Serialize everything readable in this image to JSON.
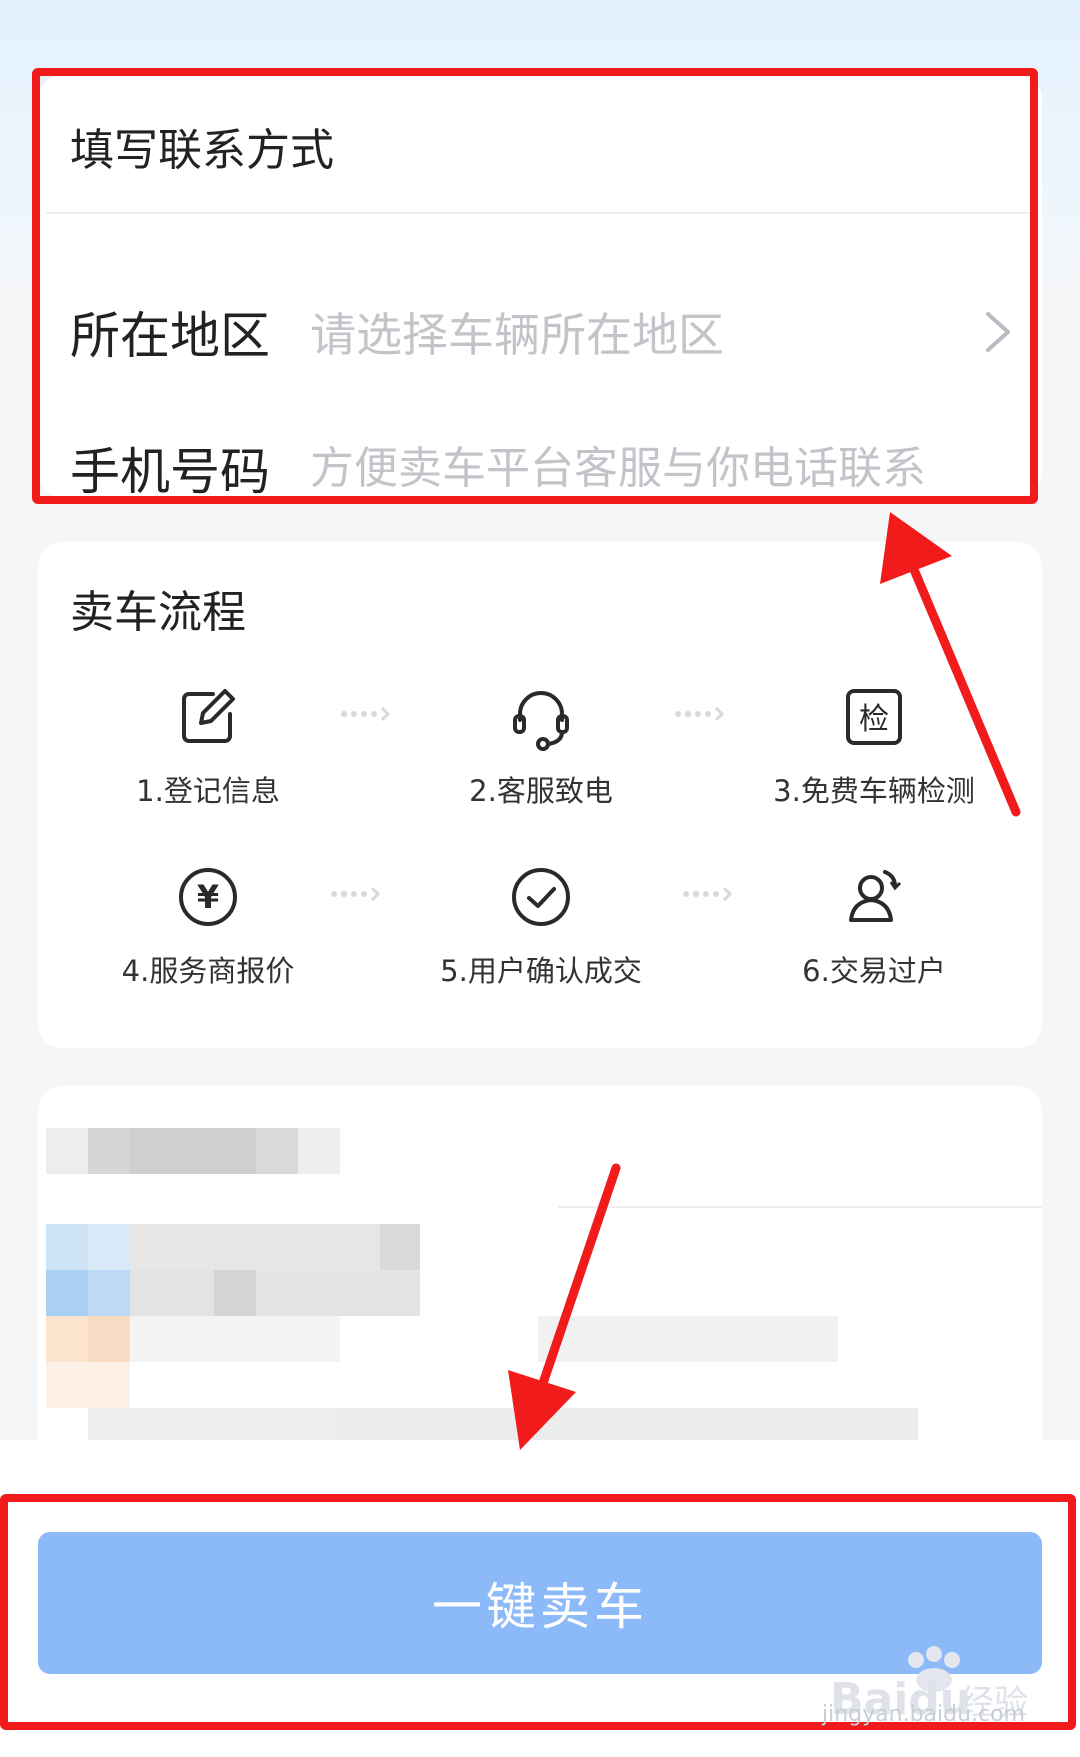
{
  "contact": {
    "title": "填写联系方式",
    "region_label": "所在地区",
    "region_placeholder": "请选择车辆所在地区",
    "phone_label": "手机号码",
    "phone_placeholder": "方便卖车平台客服与你电话联系"
  },
  "process": {
    "title": "卖车流程",
    "steps": [
      {
        "label": "1.登记信息",
        "icon": "edit-icon"
      },
      {
        "label": "2.客服致电",
        "icon": "headset-icon"
      },
      {
        "label": "3.免费车辆检测",
        "icon": "inspect-icon",
        "icon_text": "检"
      },
      {
        "label": "4.服务商报价",
        "icon": "yen-icon",
        "icon_text": "¥"
      },
      {
        "label": "5.用户确认成交",
        "icon": "check-circle-icon"
      },
      {
        "label": "6.交易过户",
        "icon": "user-transfer-icon"
      }
    ]
  },
  "action": {
    "sell_button": "一键卖车"
  },
  "watermark": {
    "brand": "Baidu",
    "suffix": "经验",
    "url": "jingyan.baidu.com"
  },
  "colors": {
    "button": "#8cbaf8",
    "annotation_red": "#f21b1b",
    "background": "#f5f6f8"
  }
}
